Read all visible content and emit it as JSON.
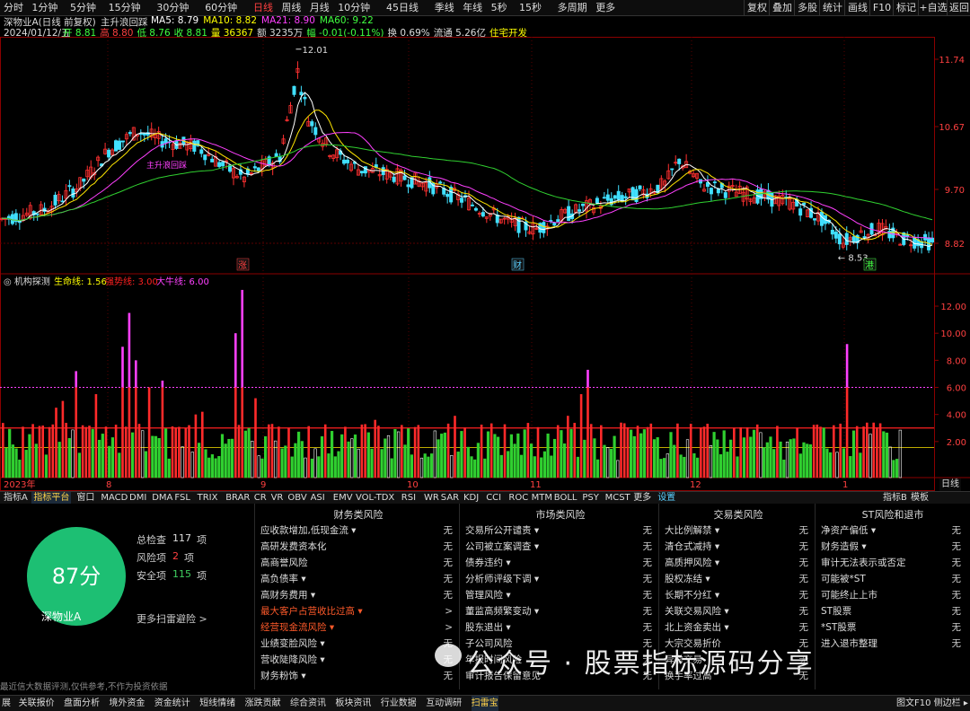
{
  "topbar": {
    "periods": [
      "分时",
      "1分钟",
      "5分钟",
      "15分钟",
      "30分钟",
      "60分钟",
      "日线",
      "周线",
      "月线",
      "10分钟",
      "45日线",
      "季线",
      "年线",
      "5秒",
      "15秒",
      "多周期",
      "更多"
    ],
    "active_period": "日线",
    "right_buttons": [
      "复权",
      "叠加",
      "多股",
      "统计",
      "画线",
      "F10",
      "标记",
      "+自选",
      "返回"
    ]
  },
  "header": {
    "title_stock": "深物业A(日线 前复权)",
    "title_indicator": "主升浪回踩",
    "ma": [
      {
        "label": "MA5: 8.79",
        "color": "#ffffff"
      },
      {
        "label": "MA10: 8.82",
        "color": "#ffff00"
      },
      {
        "label": "MA21: 8.90",
        "color": "#ff40ff"
      },
      {
        "label": "MA60: 9.22",
        "color": "#40ff40"
      }
    ],
    "date": "2024/01/12/五",
    "quote": [
      {
        "label": "开 8.81",
        "color": "#40ff40"
      },
      {
        "label": "高 8.80",
        "color": "#ff4040"
      },
      {
        "label": "低 8.76",
        "color": "#40ff40"
      },
      {
        "label": "收 8.81",
        "color": "#40ff40"
      },
      {
        "label": "量 36367",
        "color": "#ffff00"
      },
      {
        "label": "额 3235万",
        "color": "#dddddd"
      },
      {
        "label": "幅 -0.01(-0.11%)",
        "color": "#40ff40"
      },
      {
        "label": "换 0.69%",
        "color": "#dddddd"
      },
      {
        "label": "流通 5.26亿",
        "color": "#dddddd"
      },
      {
        "label": "住宅开发",
        "color": "#ffff00"
      }
    ]
  },
  "price_chart": {
    "y_ticks": [
      "11.74",
      "10.67",
      "9.70",
      "8.82"
    ],
    "high_label": "12.01",
    "low_label": "8.53",
    "markers": [
      {
        "text": "涨",
        "color": "#ff4040"
      },
      {
        "text": "财",
        "color": "#5ad0ff"
      },
      {
        "text": "港",
        "color": "#40ff40"
      }
    ],
    "signal_label": "主升浪回踩"
  },
  "indicator_chart": {
    "name": "机构探测",
    "lines": [
      {
        "label": "生命线: 1.56",
        "color": "#ffff00"
      },
      {
        "label": "强势线: 3.00",
        "color": "#ff2020"
      },
      {
        "label": "大牛线: 6.00",
        "color": "#ff40ff"
      }
    ],
    "y_ticks": [
      "12.00",
      "10.00",
      "8.00",
      "6.00",
      "4.00",
      "2.00"
    ],
    "x_labels": [
      "2023年",
      "8",
      "9",
      "10",
      "11",
      "12",
      "1"
    ]
  },
  "indicator_tabs": {
    "left": [
      "指标A",
      "指标平台",
      "窗口",
      "MACD",
      "DMI",
      "DMA",
      "FSL",
      "TRIX",
      "BRAR",
      "CR",
      "VR",
      "OBV",
      "ASI",
      "EMV",
      "VOL-TDX",
      "RSI",
      "WR",
      "SAR",
      "KDJ",
      "CCI",
      "ROC",
      "MTM",
      "BOLL",
      "PSY",
      "MCST",
      "更多",
      "设置"
    ],
    "active": "指标平台",
    "right": [
      "指标B",
      "模板"
    ],
    "right_side_label": "日线"
  },
  "scan": {
    "score": "87分",
    "stock_name": "深物业A",
    "stats": [
      {
        "label": "总检查",
        "value": "117",
        "unit": "项",
        "color": "#dddddd"
      },
      {
        "label": "风险项",
        "value": "2",
        "unit": "项",
        "color": "#ff4040"
      },
      {
        "label": "安全项",
        "value": "115",
        "unit": "项",
        "color": "#40d060"
      }
    ],
    "more_link": "更多扫雷避险 >",
    "disclaimer": "最近信大数据评测,仅供参考,不作为投资依据",
    "columns": [
      {
        "title": "财务类风险",
        "items": [
          {
            "label": "应收款增加,低现金流 ▾",
            "value": "无",
            "hl": false
          },
          {
            "label": "高研发费资本化",
            "value": "无",
            "hl": false
          },
          {
            "label": "高商誉风险",
            "value": "无",
            "hl": false
          },
          {
            "label": "高负债率 ▾",
            "value": "无",
            "hl": false
          },
          {
            "label": "高财务费用 ▾",
            "value": "无",
            "hl": false
          },
          {
            "label": "最大客户占营收比过高 ▾",
            "value": ">",
            "hl": true
          },
          {
            "label": "经营现金流风险 ▾",
            "value": ">",
            "hl": true
          },
          {
            "label": "业绩变脸风险 ▾",
            "value": "无",
            "hl": false
          },
          {
            "label": "营收陡降风险 ▾",
            "value": "无",
            "hl": false
          },
          {
            "label": "财务粉饰 ▾",
            "value": "无",
            "hl": false
          }
        ]
      },
      {
        "title": "市场类风险",
        "items": [
          {
            "label": "交易所公开谴责 ▾",
            "value": "无",
            "hl": false
          },
          {
            "label": "公司被立案调查 ▾",
            "value": "无",
            "hl": false
          },
          {
            "label": "债券违约 ▾",
            "value": "无",
            "hl": false
          },
          {
            "label": "分析师评级下调 ▾",
            "value": "无",
            "hl": false
          },
          {
            "label": "管理风险 ▾",
            "value": "无",
            "hl": false
          },
          {
            "label": "董监高频繁变动 ▾",
            "value": "无",
            "hl": false
          },
          {
            "label": "股东退出 ▾",
            "value": "无",
            "hl": false
          },
          {
            "label": "子公司风险",
            "value": "无",
            "hl": false
          },
          {
            "label": "年报时间风险",
            "value": "无",
            "hl": false
          },
          {
            "label": "审计报告保留意见",
            "value": "无",
            "hl": false
          }
        ]
      },
      {
        "title": "交易类风险",
        "items": [
          {
            "label": "大比例解禁 ▾",
            "value": "无",
            "hl": false
          },
          {
            "label": "清仓式减持 ▾",
            "value": "无",
            "hl": false
          },
          {
            "label": "高质押风险 ▾",
            "value": "无",
            "hl": false
          },
          {
            "label": "股权冻结 ▾",
            "value": "无",
            "hl": false
          },
          {
            "label": "长期不分红 ▾",
            "value": "无",
            "hl": false
          },
          {
            "label": "关联交易风险 ▾",
            "value": "无",
            "hl": false
          },
          {
            "label": "北上资金卖出 ▾",
            "value": "无",
            "hl": false
          },
          {
            "label": "大宗交易折价",
            "value": "无",
            "hl": false
          },
          {
            "label": "异常交易",
            "value": "无",
            "hl": false
          },
          {
            "label": "换手率过高",
            "value": "无",
            "hl": false
          }
        ]
      },
      {
        "title": "ST风险和退市",
        "items": [
          {
            "label": "净资产偏低 ▾",
            "value": "无",
            "hl": false
          },
          {
            "label": "财务造假 ▾",
            "value": "无",
            "hl": false
          },
          {
            "label": "审计无法表示或否定",
            "value": "无",
            "hl": false
          },
          {
            "label": "可能被*ST",
            "value": "无",
            "hl": false
          },
          {
            "label": "可能终止上市",
            "value": "无",
            "hl": false
          },
          {
            "label": "ST股票",
            "value": "无",
            "hl": false
          },
          {
            "label": "*ST股票",
            "value": "无",
            "hl": false
          },
          {
            "label": "进入退市整理",
            "value": "无",
            "hl": false
          }
        ]
      }
    ]
  },
  "watermark": "公众号 · 股票指标源码分享",
  "bottombar": {
    "tabs": [
      "展",
      "关联报价",
      "盘面分析",
      "境外资金",
      "资金统计",
      "短线情绪",
      "涨跌贡献",
      "综合资讯",
      "板块资讯",
      "行业数据",
      "互动调研",
      "扫雷宝"
    ],
    "active": "扫雷宝",
    "right": "图文F10 侧边栏 ▸"
  }
}
